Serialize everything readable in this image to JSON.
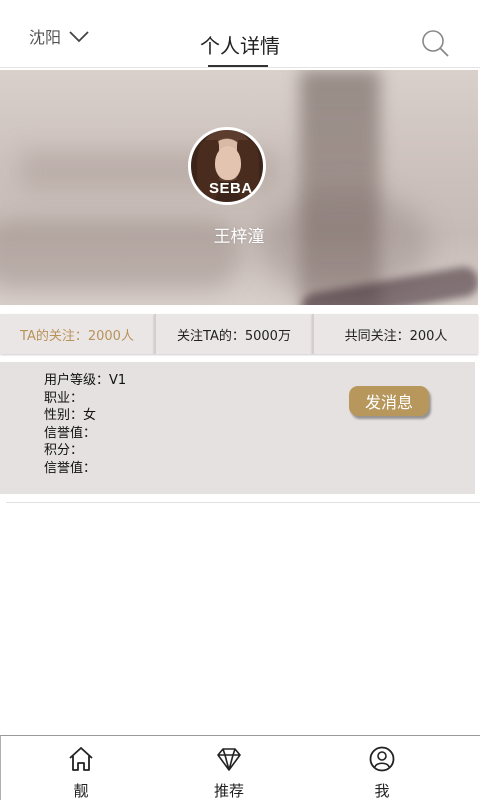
{
  "header": {
    "city": "沈阳",
    "title": "个人详情"
  },
  "profile": {
    "avatar_text": "SEBA",
    "name": "王梓潼"
  },
  "stats": [
    {
      "label": "TA的关注：2000人"
    },
    {
      "label": "关注TA的：5000万"
    },
    {
      "label": "共同关注：200人"
    }
  ],
  "info": {
    "lines": [
      "用户等级：V1",
      "职业：",
      "性别：女",
      "信誉值：",
      "积分：",
      "信誉值："
    ],
    "message_button": "发消息"
  },
  "nav": [
    {
      "label": "靓",
      "icon": "home-icon"
    },
    {
      "label": "推荐",
      "icon": "diamond-icon"
    },
    {
      "label": "我",
      "icon": "user-icon"
    }
  ],
  "colors": {
    "accent": "#b8975c",
    "active_tab_text": "#b8935a",
    "info_bg": "#e5e1e1",
    "tab_bg": "#ebe6e6"
  }
}
